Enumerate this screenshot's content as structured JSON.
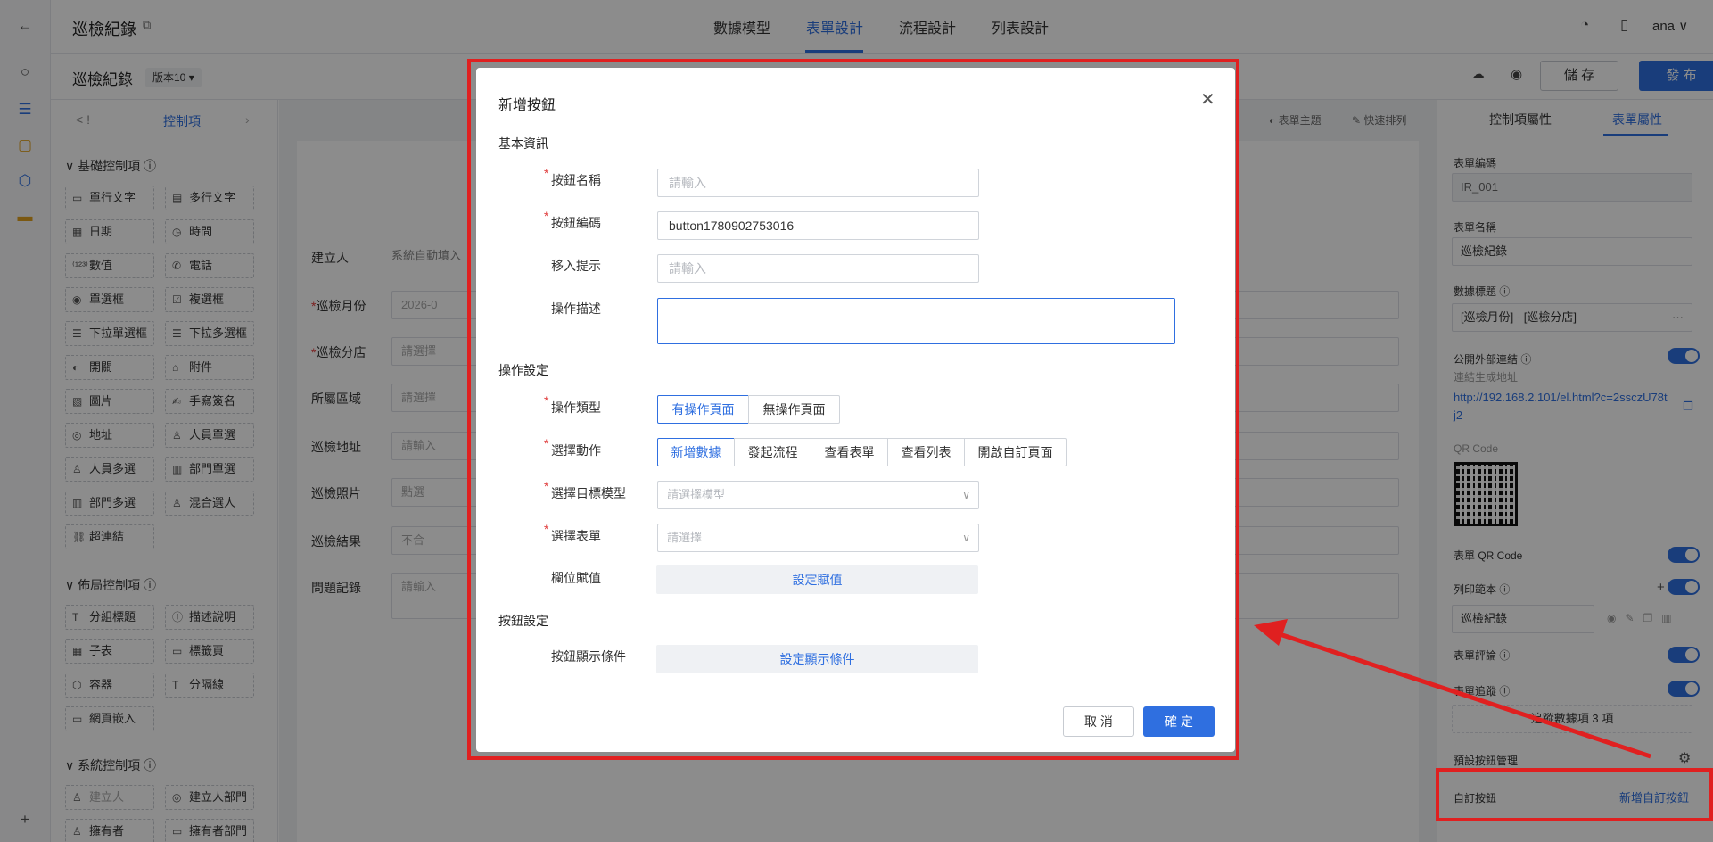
{
  "app": {
    "title": "巡檢紀錄",
    "nav_tabs": [
      {
        "label": "數據模型"
      },
      {
        "label": "表單設計"
      },
      {
        "label": "流程設計"
      },
      {
        "label": "列表設計"
      }
    ],
    "active_tab": "表單設計",
    "user": "ana",
    "form_title": "巡檢紀錄",
    "version": "版本10",
    "save_label": "儲 存",
    "publish_label": "發 布"
  },
  "palette": {
    "back_label": "< !",
    "tab_label": "控制項",
    "sections": [
      {
        "title": "基礎控制項",
        "items": [
          "單行文字",
          "多行文字",
          "日期",
          "時間",
          "數值",
          "電話",
          "單選框",
          "複選框",
          "下拉單選框",
          "下拉多選框",
          "開關",
          "附件",
          "圖片",
          "手寫簽名",
          "地址",
          "人員單選",
          "人員多選",
          "部門單選",
          "部門多選",
          "混合選人",
          "超連結"
        ]
      },
      {
        "title": "佈局控制項",
        "items": [
          "分組標題",
          "描述說明",
          "子表",
          "標籤頁",
          "容器",
          "分隔線",
          "網頁嵌入"
        ]
      },
      {
        "title": "系統控制項",
        "items": [
          "建立人",
          "建立人部門",
          "擁有者",
          "擁有者部門"
        ]
      }
    ]
  },
  "canvas": {
    "toolbar": {
      "theme": "表單主題",
      "quick": "快速排列"
    },
    "fields": [
      {
        "label": "建立人",
        "value": "系統自動填入"
      },
      {
        "label": "巡檢月份",
        "value": "2026-0"
      },
      {
        "label": "巡檢分店",
        "value": "請選擇"
      },
      {
        "label": "所屬區域",
        "value": "請選擇"
      },
      {
        "label": "巡檢地址",
        "value": "請輸入"
      },
      {
        "label": "巡檢照片",
        "value": "點選"
      },
      {
        "label": "巡檢結果",
        "value": "不合"
      },
      {
        "label": "問題記錄",
        "value": "請輸入"
      }
    ]
  },
  "properties": {
    "tabs": [
      "控制項屬性",
      "表單屬性"
    ],
    "form_code_label": "表單編碼",
    "form_code": "IR_001",
    "form_name_label": "表單名稱",
    "form_name": "巡檢紀錄",
    "data_title_label": "數據標題",
    "data_title": "[巡檢月份] - [巡檢分店]",
    "public_link_label": "公開外部連結",
    "link_hint": "連結生成地址",
    "link_url": "http://192.168.2.101/el.html?c=2ssczU78tj2",
    "qr_label": "QR Code",
    "form_qr_label": "表單 QR Code",
    "print_label": "列印範本",
    "print_value": "巡檢紀錄",
    "comment_label": "表單評論",
    "track_label": "表單追蹤",
    "track_button": "追蹤數據項 3 項",
    "preset_btn_label": "預設按鈕管理",
    "custom_btn_label": "自訂按鈕",
    "add_custom_btn": "新增自訂按鈕"
  },
  "modal": {
    "title": "新增按鈕",
    "basic_section": "基本資訊",
    "name_label": "按鈕名稱",
    "name_placeholder": "請輸入",
    "code_label": "按鈕編碼",
    "code_value": "button1780902753016",
    "hover_label": "移入提示",
    "hover_placeholder": "請輸入",
    "desc_label": "操作描述",
    "op_section": "操作設定",
    "op_type_label": "操作類型",
    "op_types": [
      "有操作頁面",
      "無操作頁面"
    ],
    "action_label": "選擇動作",
    "actions": [
      "新增數據",
      "發起流程",
      "查看表單",
      "查看列表",
      "開啟自訂頁面"
    ],
    "target_model_label": "選擇目標模型",
    "target_model_placeholder": "請選擇模型",
    "form_select_label": "選擇表單",
    "form_select_placeholder": "請選擇",
    "field_assign_label": "欄位賦值",
    "field_assign_button": "設定賦值",
    "btn_section": "按鈕設定",
    "display_cond_label": "按鈕顯示條件",
    "display_cond_button": "設定顯示條件",
    "cancel_label": "取 消",
    "ok_label": "確 定"
  },
  "colors": {
    "accent": "#2f6fe0",
    "annotation": "#e02020"
  }
}
